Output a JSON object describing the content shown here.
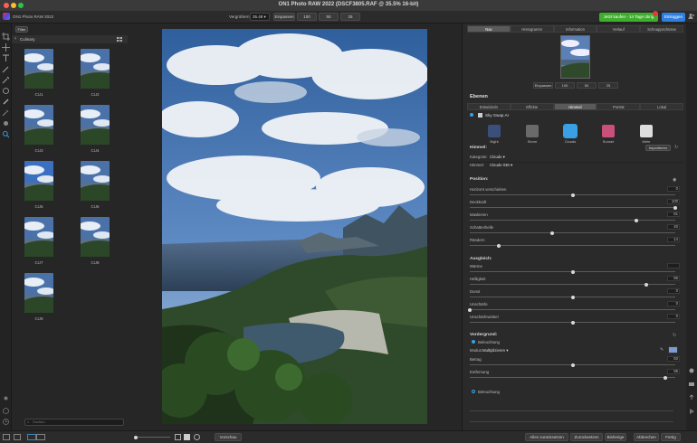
{
  "window": {
    "title": "ON1 Photo RAW 2022 (DSCF3805.RAF @ 35.5% 16-bit)",
    "traffic_colors": [
      "#ff5f57",
      "#febc2e",
      "#28c840"
    ]
  },
  "topbar": {
    "app_name": "ON1 Photo RAW 2022",
    "zoom_label": "Vergrößern:",
    "zoom_value": "35.48",
    "zoom_buttons": [
      "Einpassen",
      "100",
      "50",
      "25"
    ],
    "trial_label": "Jetzt kaufen - 14 Tage übrig",
    "trial_badge": "",
    "buy_label": "Einloggen"
  },
  "browser": {
    "filter_label": "Filter",
    "folder_name": "Culinary",
    "thumbnails": [
      {
        "label": "CU1"
      },
      {
        "label": "CU2"
      },
      {
        "label": "CU3"
      },
      {
        "label": "CU4"
      },
      {
        "label": "CU5"
      },
      {
        "label": "CU6"
      },
      {
        "label": "CU7"
      },
      {
        "label": "CU8"
      },
      {
        "label": "CU9"
      }
    ],
    "search_placeholder": "Suchen"
  },
  "bottombar": {
    "preview_label": "Vorschau",
    "buttons_right": [
      "Alles zurücksetzen",
      "Zurücksetzen",
      "Bisherige",
      "Abbrechen",
      "Fertig"
    ]
  },
  "navigator": {
    "tabs": [
      "Nav",
      "Histogramm",
      "Information",
      "Verlauf",
      "Schnappschüsse"
    ],
    "active_tab": "Nav",
    "zoom_buttons": [
      "Einpassen",
      "100",
      "50",
      "25"
    ]
  },
  "layers": {
    "title": "Ebenen",
    "module_tabs": [
      "Entwickeln",
      "Effekte",
      "Himmel",
      "Porträt",
      "Lokal"
    ],
    "active_module": "Himmel",
    "filter_name": "Sky Swap AI",
    "presets": [
      {
        "label": "Night",
        "icon": "night-icon"
      },
      {
        "label": "Storm",
        "icon": "storm-icon"
      },
      {
        "label": "Clouds",
        "icon": "clouds-icon"
      },
      {
        "label": "Sunset",
        "icon": "sunset-icon"
      },
      {
        "label": "Mehr",
        "icon": "more-icon"
      }
    ],
    "sky": {
      "title": "Himmel:",
      "import_label": "Importieren",
      "category_label": "Kategorie:",
      "category_value": "Clouds",
      "sky_label": "Himmel:",
      "sky_value": "Clouds 036"
    },
    "position": {
      "title": "Position:",
      "rows": [
        {
          "label": "Horizont verschieben",
          "value": "0",
          "level": 0.5
        },
        {
          "label": "Deckkraft",
          "value": "100",
          "level": 1.0
        },
        {
          "label": "Maskieren",
          "value": "81",
          "level": 0.81
        },
        {
          "label": "Schattenhelle",
          "value": "40",
          "level": 0.4
        },
        {
          "label": "Rändern",
          "value": "14",
          "level": 0.14
        }
      ]
    },
    "adjust": {
      "title": "Ausgleich:",
      "rows": [
        {
          "label": "Wärme",
          "value": "",
          "level": 0.5
        },
        {
          "label": "Helligkeit",
          "value": "86",
          "level": 0.86
        },
        {
          "label": "Dunst",
          "value": "0",
          "level": 0.5
        },
        {
          "label": "Unschärfe",
          "value": "0",
          "level": 0.0
        },
        {
          "label": "Unschärfewinkel",
          "value": "0",
          "level": 0.5
        }
      ]
    },
    "foreground": {
      "title": "Vordergrund:",
      "lighting_label": "Beleuchtung",
      "mode_label": "Modus:",
      "mode_value": "Multiplizieren",
      "rows": [
        {
          "label": "Betrag",
          "value": "50",
          "level": 0.5
        },
        {
          "label": "Entfernung",
          "value": "95",
          "level": 0.95
        }
      ],
      "lighting2_label": "Beleuchtung"
    },
    "colors": {
      "accent": "#3aa0e6",
      "swatch": "#7a9cd0"
    }
  }
}
